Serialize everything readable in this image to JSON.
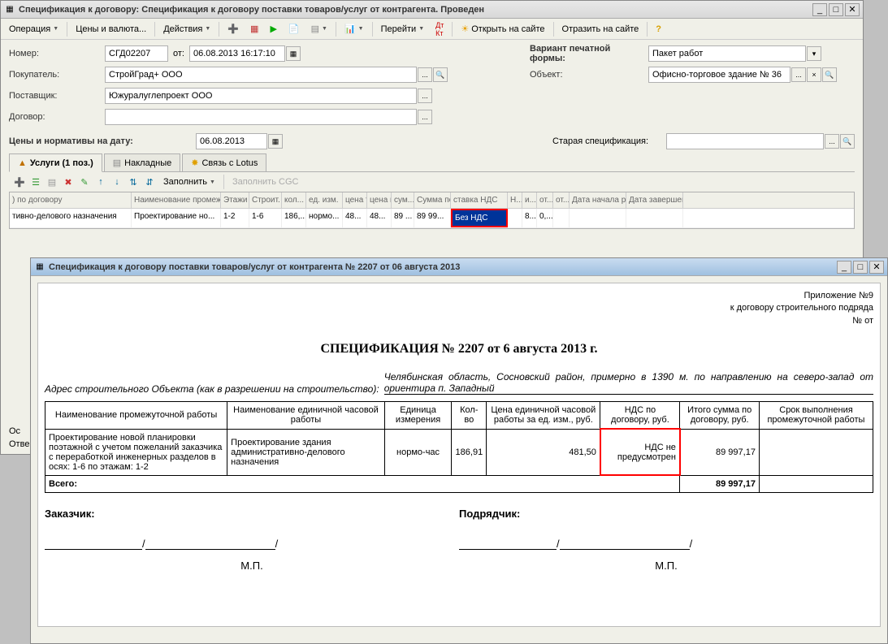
{
  "window1": {
    "title": "Спецификация к договору: Спецификация к договору поставки товаров/услуг от контрагента. Проведен",
    "toolbar": {
      "operation": "Операция",
      "prices": "Цены и валюта...",
      "actions": "Действия",
      "goto": "Перейти",
      "open_site": "Открыть на сайте",
      "reflect_site": "Отразить на сайте"
    },
    "form": {
      "number_label": "Номер:",
      "number_value": "СГД02207",
      "from_label": "от:",
      "from_value": "06.08.2013 16:17:10",
      "buyer_label": "Покупатель:",
      "buyer_value": "СтройГрад+ ООО",
      "supplier_label": "Поставщик:",
      "supplier_value": "Южуралуглепроект ООО",
      "contract_label": "Договор:",
      "contract_value": "",
      "variant_label": "Вариант печатной формы:",
      "variant_value": "Пакет работ",
      "object_label": "Объект:",
      "object_value": "Офисно-торговое здание № 36",
      "norms_label": "Цены и нормативы на дату:",
      "norms_value": "06.08.2013",
      "old_spec_label": "Старая спецификация:",
      "old_spec_value": ""
    },
    "tabs": {
      "services": "Услуги (1 поз.)",
      "invoices": "Накладные",
      "lotus": "Связь с Lotus"
    },
    "tab_toolbar": {
      "fill": "Заполнить",
      "fill_cgc": "Заполнить CGC"
    },
    "grid": {
      "headers": [
        ") по договору",
        "Наименование промежуточной",
        "Этажи",
        "Строит. оси",
        "кол... еди...",
        "ед. изм.",
        "цена тов...",
        "цена по...",
        "сум...",
        "Сумма по",
        "ставка НДС",
        "Н...",
        "и... су...",
        "от... це...",
        "от...",
        "Дата начала работы",
        "Дата завершения"
      ],
      "row": [
        "тивно-делового назначения",
        "Проектирование но...",
        "1-2",
        "1-6",
        "186,...",
        "нормо...",
        "48...",
        "48...",
        "89 ...",
        "89 99...",
        "Без НДС",
        "",
        "8...",
        "0,...",
        "",
        "",
        ""
      ]
    },
    "footer": {
      "os": "Ос",
      "resp": "Отве"
    }
  },
  "window2": {
    "title": "Спецификация к договору поставки товаров/услуг от контрагента № 2207 от 06 августа 2013",
    "appendix": "Приложение №9",
    "to_contract": "к договору строительного подряда",
    "no_from": "№ от",
    "spec_title": "СПЕЦИФИКАЦИЯ № 2207 от 6 августа 2013 г.",
    "address_label": "Адрес строительного Объекта (как в разрешении на строительство):",
    "address_value": "Челябинская область, Сосновский район, примерно в 1390 м. по направлению на северо-запад от ориентира п. Западный",
    "table": {
      "headers": [
        "Наименование промежуточной работы",
        "Наименование единичной часовой работы",
        "Единица измерения",
        "Кол-во",
        "Цена единичной часовой работы за ед. изм., руб.",
        "НДС по договору, руб.",
        "Итого сумма по договору, руб.",
        "Срок выполнения промежуточной работы"
      ],
      "row": {
        "name_interim": "Проектирование новой планировки поэтажной с учетом пожеланий заказчика с переработкой инженерных разделов в осях: 1-6 по этажам: 1-2",
        "name_unit": "Проектирование здания административно-делового назначения",
        "unit": "нормо-час",
        "qty": "186,91",
        "price": "481,50",
        "vat": "НДС не предусмотрен",
        "total": "89 997,17",
        "term": ""
      },
      "total_label": "Всего:",
      "total_value": "89 997,17"
    },
    "sign": {
      "customer": "Заказчик:",
      "contractor": "Подрядчик:",
      "mp": "М.П."
    }
  }
}
